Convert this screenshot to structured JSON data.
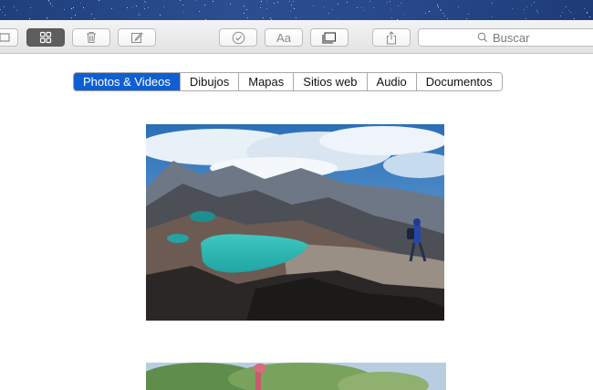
{
  "toolbar": {
    "buttons": [
      {
        "name": "sidebar-toggle",
        "icon": "sidebar-icon"
      },
      {
        "name": "grid-view",
        "icon": "grid-icon"
      },
      {
        "name": "delete",
        "icon": "trash-icon"
      },
      {
        "name": "compose",
        "icon": "compose-icon"
      },
      {
        "name": "checklist",
        "icon": "checkmark-circle-icon"
      },
      {
        "name": "format",
        "icon": "format-text-icon",
        "label": "Aa"
      },
      {
        "name": "table",
        "icon": "table-icon"
      },
      {
        "name": "share",
        "icon": "share-icon"
      }
    ],
    "search": {
      "placeholder": "Buscar",
      "icon": "search-icon"
    }
  },
  "filter_tabs": [
    {
      "label": "Photos & Videos",
      "selected": true
    },
    {
      "label": "Dibujos",
      "selected": false
    },
    {
      "label": "Mapas",
      "selected": false
    },
    {
      "label": "Sitios web",
      "selected": false
    },
    {
      "label": "Audio",
      "selected": false
    },
    {
      "label": "Documentos",
      "selected": false
    }
  ],
  "colors": {
    "accent": "#0f5fd3",
    "desktop": "#2c4f91",
    "toolbar": "#ececec"
  }
}
